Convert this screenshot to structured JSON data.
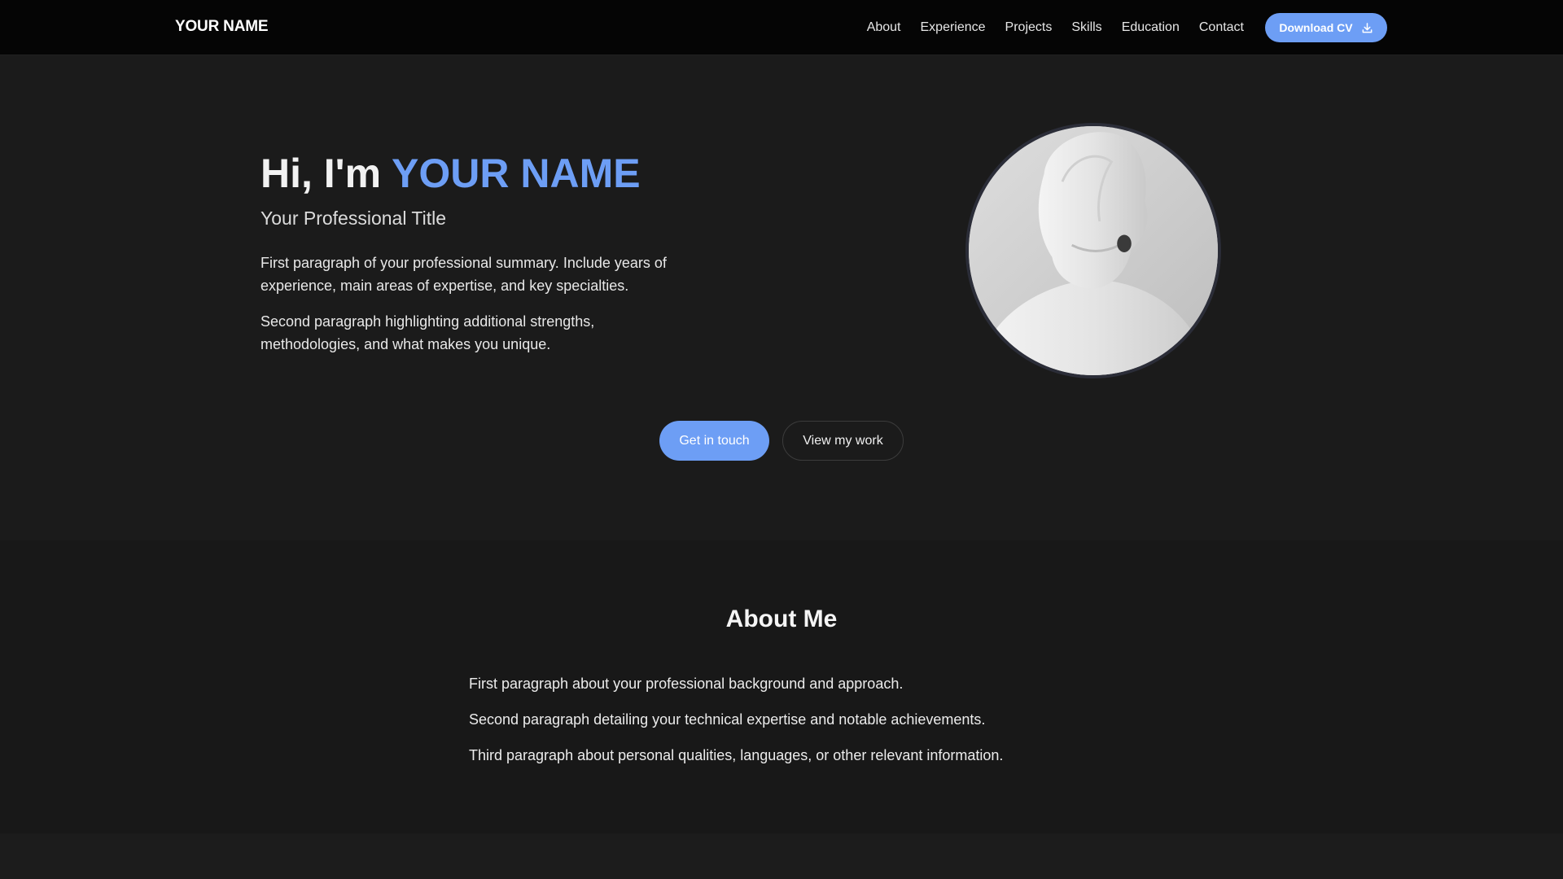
{
  "nav": {
    "brand": "YOUR NAME",
    "links": [
      "About",
      "Experience",
      "Projects",
      "Skills",
      "Education",
      "Contact"
    ],
    "cv_button": "Download CV"
  },
  "hero": {
    "greeting": "Hi, I'm",
    "name": "YOUR NAME",
    "subtitle": "Your Professional Title",
    "paragraph1": "First paragraph of your professional summary. Include years of experience, main areas of expertise, and key specialties.",
    "paragraph2": "Second paragraph highlighting additional strengths, methodologies, and what makes you unique.",
    "primary_button": "Get in touch",
    "secondary_button": "View my work"
  },
  "about": {
    "title": "About Me",
    "paragraphs": [
      "First paragraph about your professional background and approach.",
      "Second paragraph detailing your technical expertise and notable achievements.",
      "Third paragraph about personal qualities, languages, or other relevant information."
    ]
  },
  "colors": {
    "accent": "#6d9ef5",
    "background": "#1b1b1b",
    "navbar": "#050505"
  },
  "icons": {
    "cv_button_icon": "download-icon"
  }
}
